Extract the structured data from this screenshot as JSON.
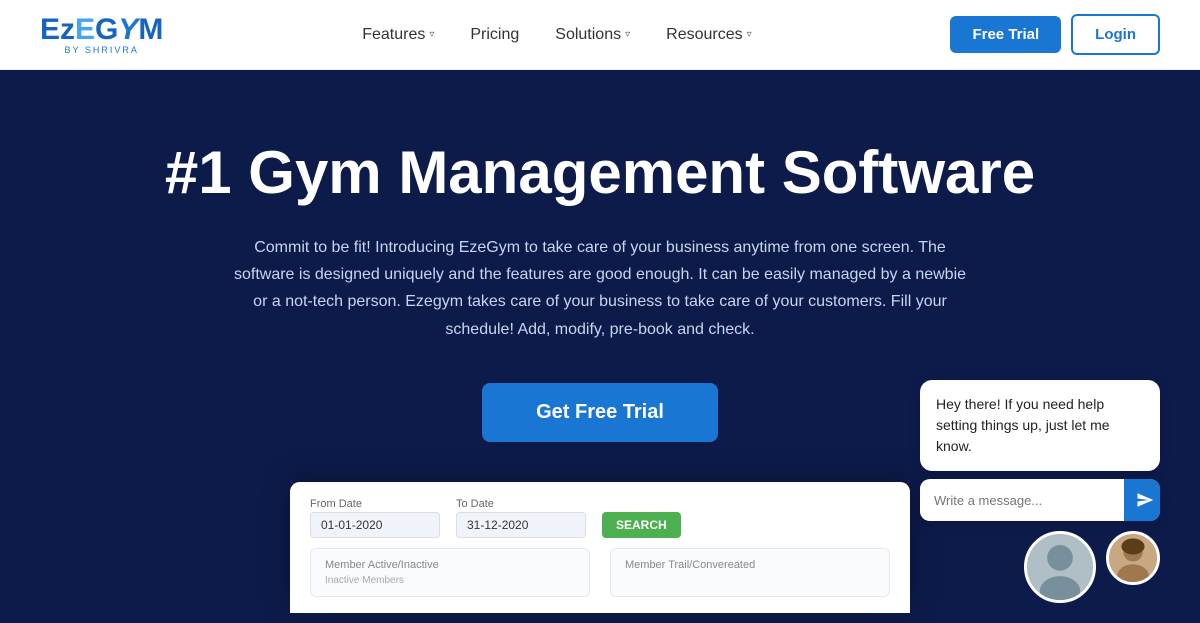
{
  "navbar": {
    "logo_brand": "EzEGYM",
    "logo_sub": "BY SHRIVRA",
    "nav_items": [
      {
        "label": "Features",
        "has_dropdown": true
      },
      {
        "label": "Pricing",
        "has_dropdown": false
      },
      {
        "label": "Solutions",
        "has_dropdown": true
      },
      {
        "label": "Resources",
        "has_dropdown": true
      }
    ],
    "free_trial_label": "Free Trial",
    "login_label": "Login"
  },
  "hero": {
    "title": "#1 Gym Management Software",
    "description": "Commit to be fit! Introducing EzeGym to take care of your business anytime from one screen. The software is designed uniquely and the features are good enough. It can be easily managed by a newbie or a not-tech person. Ezegym takes care of your business to take care of your customers. Fill your schedule! Add, modify, pre-book and check.",
    "cta_label": "Get Free Trial"
  },
  "dashboard_preview": {
    "from_date_label": "From Date",
    "from_date_value": "01-01-2020",
    "to_date_label": "To Date",
    "to_date_value": "31-12-2020",
    "search_label": "SEARCH",
    "card1_title": "Member Active/Inactive",
    "card1_sub": "Inactive Members",
    "card2_title": "Member Trail/Convereated"
  },
  "chat_widget": {
    "bubble_text": "Hey there! If you need help setting things up, just let me know.",
    "input_placeholder": "Write a message...",
    "send_icon": "send"
  }
}
